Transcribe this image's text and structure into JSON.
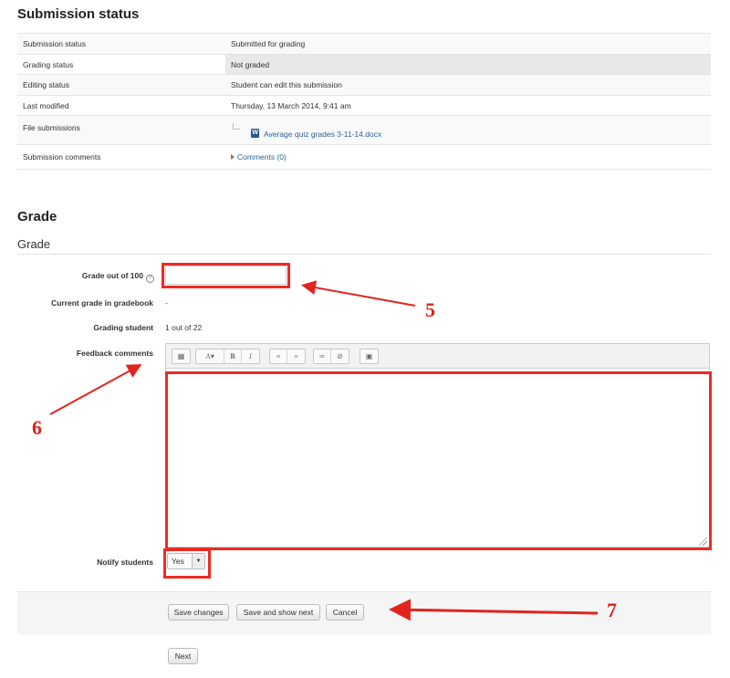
{
  "submission": {
    "heading": "Submission status",
    "rows": [
      {
        "label": "Submission status",
        "value": "Submitted for grading"
      },
      {
        "label": "Grading status",
        "value": "Not graded"
      },
      {
        "label": "Editing status",
        "value": "Student can edit this submission"
      },
      {
        "label": "Last modified",
        "value": "Thursday, 13 March 2014, 9:41 am"
      },
      {
        "label": "File submissions",
        "value": "Average quiz grades 3-11-14.docx"
      },
      {
        "label": "Submission comments",
        "value": "Comments (0)"
      }
    ]
  },
  "grade": {
    "heading": "Grade",
    "subheading": "Grade",
    "grade_out_of_label": "Grade out of 100",
    "grade_value": "",
    "current_grade_label": "Current grade in gradebook",
    "current_grade_value": "-",
    "grading_student_label": "Grading student",
    "grading_student_value": "1 out of 22",
    "feedback_label": "Feedback comments",
    "feedback_value": "",
    "notify_label": "Notify students",
    "notify_value": "Yes"
  },
  "editor_toolbar": {
    "icons": [
      "collapse-icon",
      "font-style-icon",
      "bold-icon",
      "italic-icon",
      "unordered-list-icon",
      "ordered-list-icon",
      "link-icon",
      "unlink-icon",
      "image-icon"
    ],
    "bold": "B",
    "italic": "I"
  },
  "buttons": {
    "save": "Save changes",
    "save_next": "Save and show next",
    "cancel": "Cancel",
    "next": "Next"
  },
  "annotations": {
    "callout_5": "5",
    "callout_6": "6",
    "callout_7": "7",
    "highlight_color": "#ee2a24"
  },
  "colors": {
    "link": "#2a6496",
    "warning_text": "#e0211d"
  }
}
